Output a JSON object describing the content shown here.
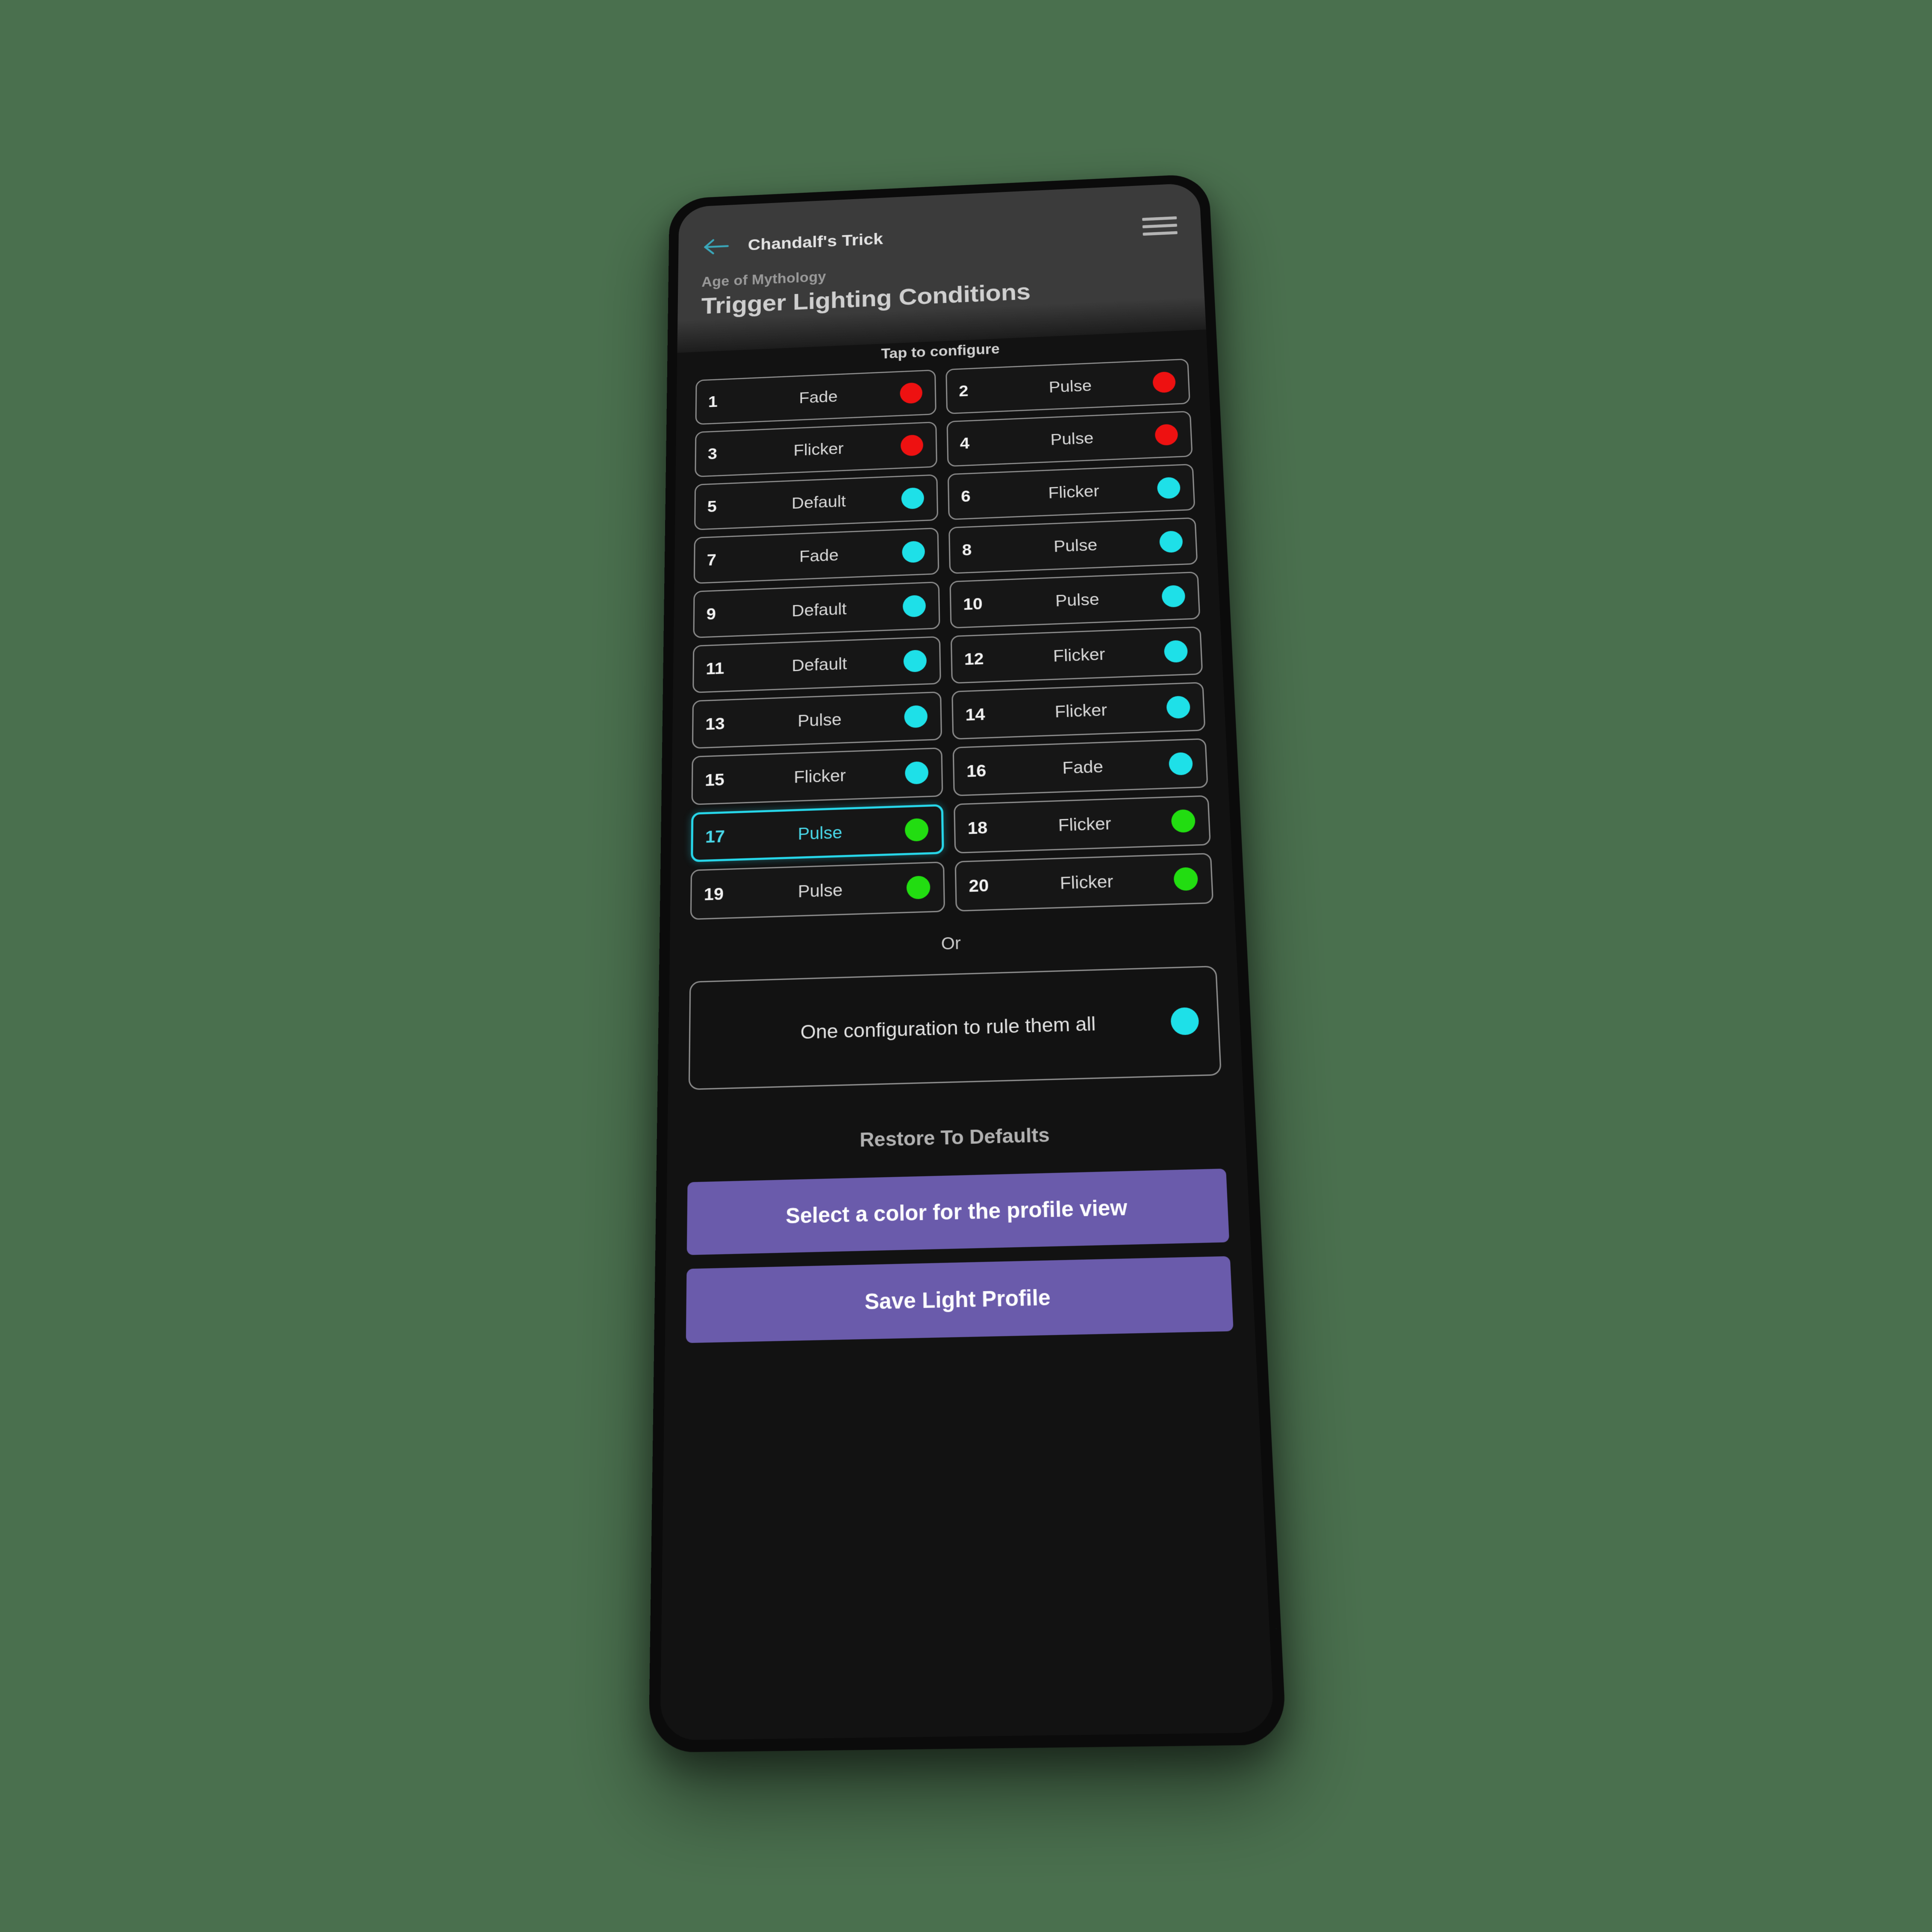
{
  "background_color": "#4a704e",
  "header": {
    "back_icon": "arrow-left-icon",
    "title": "Chandalf's Trick",
    "menu_icon": "hamburger-menu-icon",
    "eyebrow": "Age of Mythology",
    "page_title": "Trigger Lighting Conditions"
  },
  "hint": "Tap to configure",
  "colors": {
    "red": "#ee1111",
    "cyan": "#1ee0e8",
    "green": "#22dd11",
    "accent_purple": "#6a5bab",
    "selected_border": "#27d7ea"
  },
  "conditions": [
    {
      "index": "1",
      "mode": "Fade",
      "color": "#ee1111",
      "selected": false
    },
    {
      "index": "2",
      "mode": "Pulse",
      "color": "#ee1111",
      "selected": false
    },
    {
      "index": "3",
      "mode": "Flicker",
      "color": "#ee1111",
      "selected": false
    },
    {
      "index": "4",
      "mode": "Pulse",
      "color": "#ee1111",
      "selected": false
    },
    {
      "index": "5",
      "mode": "Default",
      "color": "#1ee0e8",
      "selected": false
    },
    {
      "index": "6",
      "mode": "Flicker",
      "color": "#1ee0e8",
      "selected": false
    },
    {
      "index": "7",
      "mode": "Fade",
      "color": "#1ee0e8",
      "selected": false
    },
    {
      "index": "8",
      "mode": "Pulse",
      "color": "#1ee0e8",
      "selected": false
    },
    {
      "index": "9",
      "mode": "Default",
      "color": "#1ee0e8",
      "selected": false
    },
    {
      "index": "10",
      "mode": "Pulse",
      "color": "#1ee0e8",
      "selected": false
    },
    {
      "index": "11",
      "mode": "Default",
      "color": "#1ee0e8",
      "selected": false
    },
    {
      "index": "12",
      "mode": "Flicker",
      "color": "#1ee0e8",
      "selected": false
    },
    {
      "index": "13",
      "mode": "Pulse",
      "color": "#1ee0e8",
      "selected": false
    },
    {
      "index": "14",
      "mode": "Flicker",
      "color": "#1ee0e8",
      "selected": false
    },
    {
      "index": "15",
      "mode": "Flicker",
      "color": "#1ee0e8",
      "selected": false
    },
    {
      "index": "16",
      "mode": "Fade",
      "color": "#1ee0e8",
      "selected": false
    },
    {
      "index": "17",
      "mode": "Pulse",
      "color": "#22dd11",
      "selected": true
    },
    {
      "index": "18",
      "mode": "Flicker",
      "color": "#22dd11",
      "selected": false
    },
    {
      "index": "19",
      "mode": "Pulse",
      "color": "#22dd11",
      "selected": false
    },
    {
      "index": "20",
      "mode": "Flicker",
      "color": "#22dd11",
      "selected": false
    }
  ],
  "divider_label": "Or",
  "global_config": {
    "label": "One configuration to rule them all",
    "color": "#1ee0e8"
  },
  "restore_label": "Restore To Defaults",
  "buttons": {
    "select_color": "Select a color for the profile view",
    "save_profile": "Save Light Profile"
  }
}
